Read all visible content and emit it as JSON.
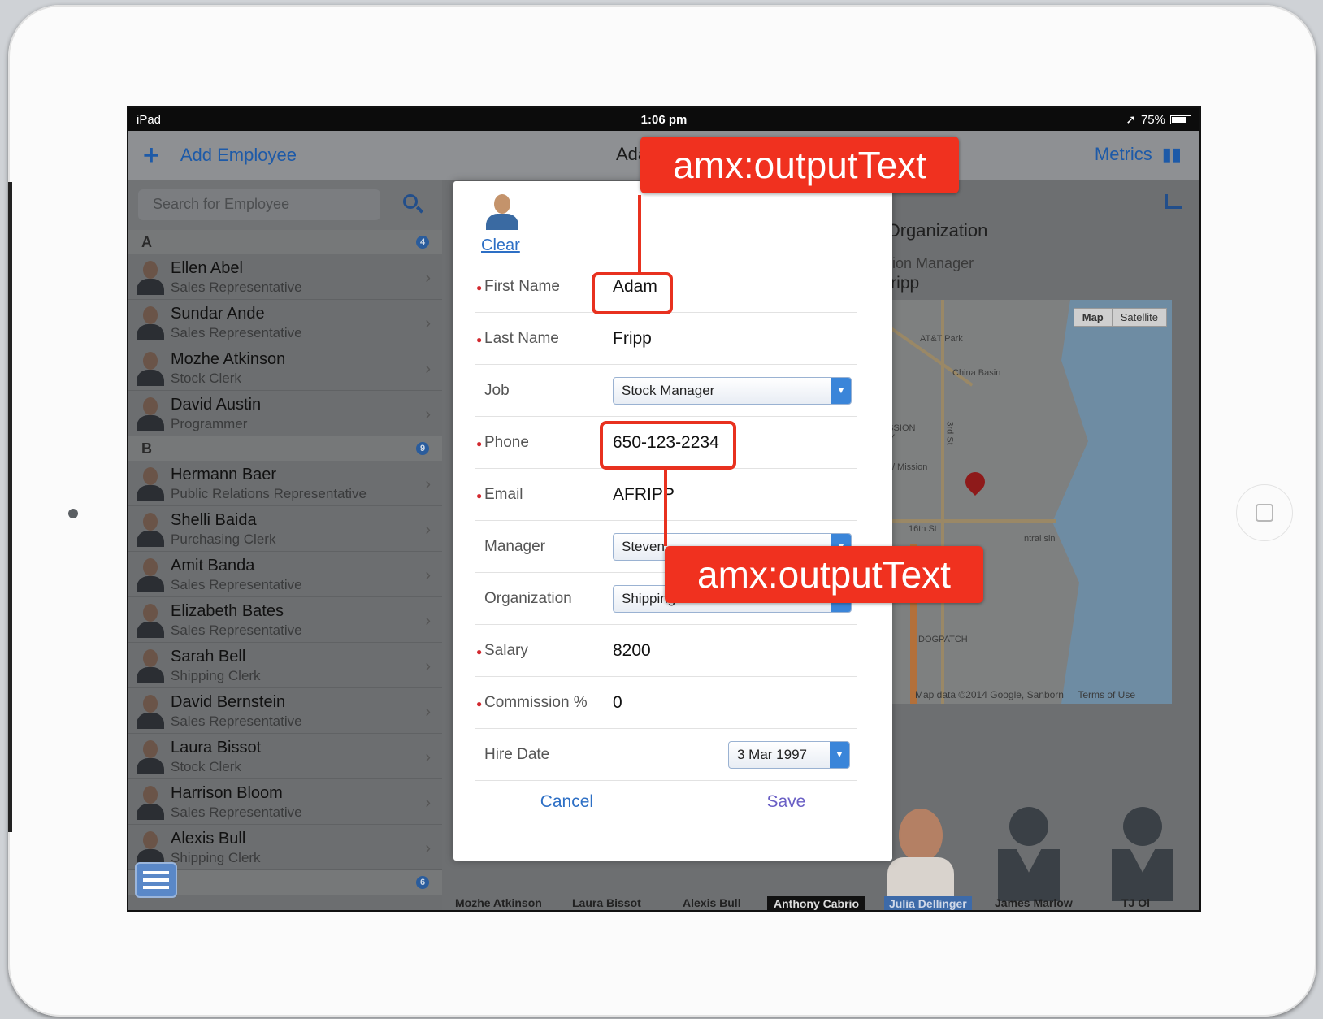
{
  "status_bar": {
    "device": "iPad",
    "time": "1:06 pm",
    "battery": "75%"
  },
  "nav": {
    "add_label": "Add Employee",
    "title_fragment": "Ada",
    "metrics_label": "Metrics"
  },
  "sidebar": {
    "search_placeholder": "Search for Employee",
    "sections": [
      {
        "letter": "A",
        "count": "4",
        "items": [
          {
            "name": "Ellen Abel",
            "title": "Sales Representative"
          },
          {
            "name": "Sundar Ande",
            "title": "Sales Representative"
          },
          {
            "name": "Mozhe Atkinson",
            "title": "Stock Clerk"
          },
          {
            "name": "David Austin",
            "title": "Programmer"
          }
        ]
      },
      {
        "letter": "B",
        "count": "9",
        "items": [
          {
            "name": "Hermann Baer",
            "title": "Public Relations Representative"
          },
          {
            "name": "Shelli Baida",
            "title": "Purchasing Clerk"
          },
          {
            "name": "Amit Banda",
            "title": "Sales Representative"
          },
          {
            "name": "Elizabeth Bates",
            "title": "Sales Representative"
          },
          {
            "name": "Sarah Bell",
            "title": "Shipping Clerk"
          },
          {
            "name": "David Bernstein",
            "title": "Sales Representative"
          },
          {
            "name": "Laura Bissot",
            "title": "Stock Clerk"
          },
          {
            "name": "Harrison Bloom",
            "title": "Sales Representative"
          },
          {
            "name": "Alexis Bull",
            "title": "Shipping Clerk"
          }
        ]
      },
      {
        "count": "6"
      }
    ]
  },
  "detail": {
    "section_title": "ng Organization",
    "manager_label": "nization Manager",
    "manager_value": "m Fripp",
    "map": {
      "toggle": [
        "Map",
        "Satellite"
      ],
      "labels": [
        "AT&T Park",
        "China Basin",
        "MISSION BAY",
        "UCSF/ Mission Bay",
        "3rd St",
        "16th St",
        "DOGPATCH",
        "ntral sin"
      ],
      "credit": "Map data ©2014 Google, Sanborn",
      "terms": "Terms of Use"
    },
    "strip": [
      "Mozhe Atkinson",
      "Laura Bissot",
      "Alexis Bull",
      "Anthony Cabrio",
      "Julia Dellinger",
      "James Marlow",
      "TJ Ol"
    ]
  },
  "modal": {
    "clear_label": "Clear",
    "fields": [
      {
        "label": "First Name",
        "value": "Adam",
        "required": true,
        "type": "text"
      },
      {
        "label": "Last Name",
        "value": "Fripp",
        "required": true,
        "type": "text"
      },
      {
        "label": "Job",
        "value": "Stock Manager",
        "required": false,
        "type": "select"
      },
      {
        "label": "Phone",
        "value": "650-123-2234",
        "required": true,
        "type": "text"
      },
      {
        "label": "Email",
        "value": "AFRIPP",
        "required": true,
        "type": "text"
      },
      {
        "label": "Manager",
        "value": "Steven",
        "required": false,
        "type": "select"
      },
      {
        "label": "Organization",
        "value": "Shipping",
        "required": false,
        "type": "select"
      },
      {
        "label": "Salary",
        "value": "8200",
        "required": true,
        "type": "text"
      },
      {
        "label": "Commission %",
        "value": "0",
        "required": true,
        "type": "text"
      },
      {
        "label": "Hire Date",
        "value": "3 Mar 1997",
        "required": false,
        "type": "date"
      }
    ],
    "cancel_label": "Cancel",
    "save_label": "Save"
  },
  "callouts": {
    "top": "amx:outputText",
    "bottom": "amx:outputText"
  },
  "colors": {
    "callout": "#f0311f",
    "link_blue": "#2d6fc5",
    "required": "#d2282e"
  }
}
